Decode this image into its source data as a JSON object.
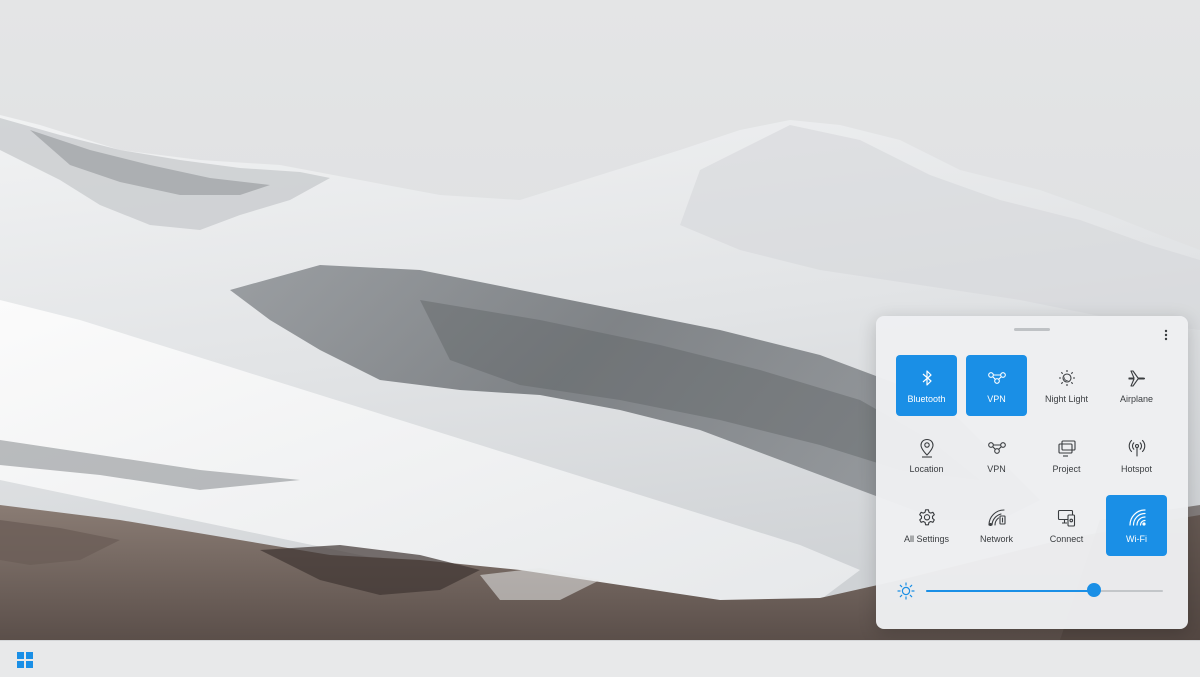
{
  "accent_color": "#1a8fe6",
  "wallpaper": {
    "subject": "snow-covered-mountains"
  },
  "taskbar": {
    "start_icon": "windows-logo-icon"
  },
  "quick_settings": {
    "more_icon": "more-vertical-icon",
    "tiles": [
      {
        "id": "bluetooth",
        "label": "Bluetooth",
        "icon": "bluetooth-icon",
        "active": true
      },
      {
        "id": "vpn",
        "label": "VPN",
        "icon": "vpn-icon",
        "active": true
      },
      {
        "id": "night-light",
        "label": "Night Light",
        "icon": "night-light-icon",
        "active": false
      },
      {
        "id": "airplane",
        "label": "Airplane",
        "icon": "airplane-icon",
        "active": false
      },
      {
        "id": "location",
        "label": "Location",
        "icon": "location-pin-icon",
        "active": false
      },
      {
        "id": "vpn-2",
        "label": "VPN",
        "icon": "vpn-icon",
        "active": false
      },
      {
        "id": "project",
        "label": "Project",
        "icon": "project-icon",
        "active": false
      },
      {
        "id": "hotspot",
        "label": "Hotspot",
        "icon": "hotspot-icon",
        "active": false
      },
      {
        "id": "all-settings",
        "label": "All Settings",
        "icon": "gear-icon",
        "active": false
      },
      {
        "id": "network",
        "label": "Network",
        "icon": "network-icon",
        "active": false
      },
      {
        "id": "connect",
        "label": "Connect",
        "icon": "connect-icon",
        "active": false
      },
      {
        "id": "wifi",
        "label": "Wi-Fi",
        "icon": "wifi-icon",
        "active": true
      }
    ],
    "brightness": {
      "icon": "brightness-icon",
      "level": 0.71
    }
  }
}
